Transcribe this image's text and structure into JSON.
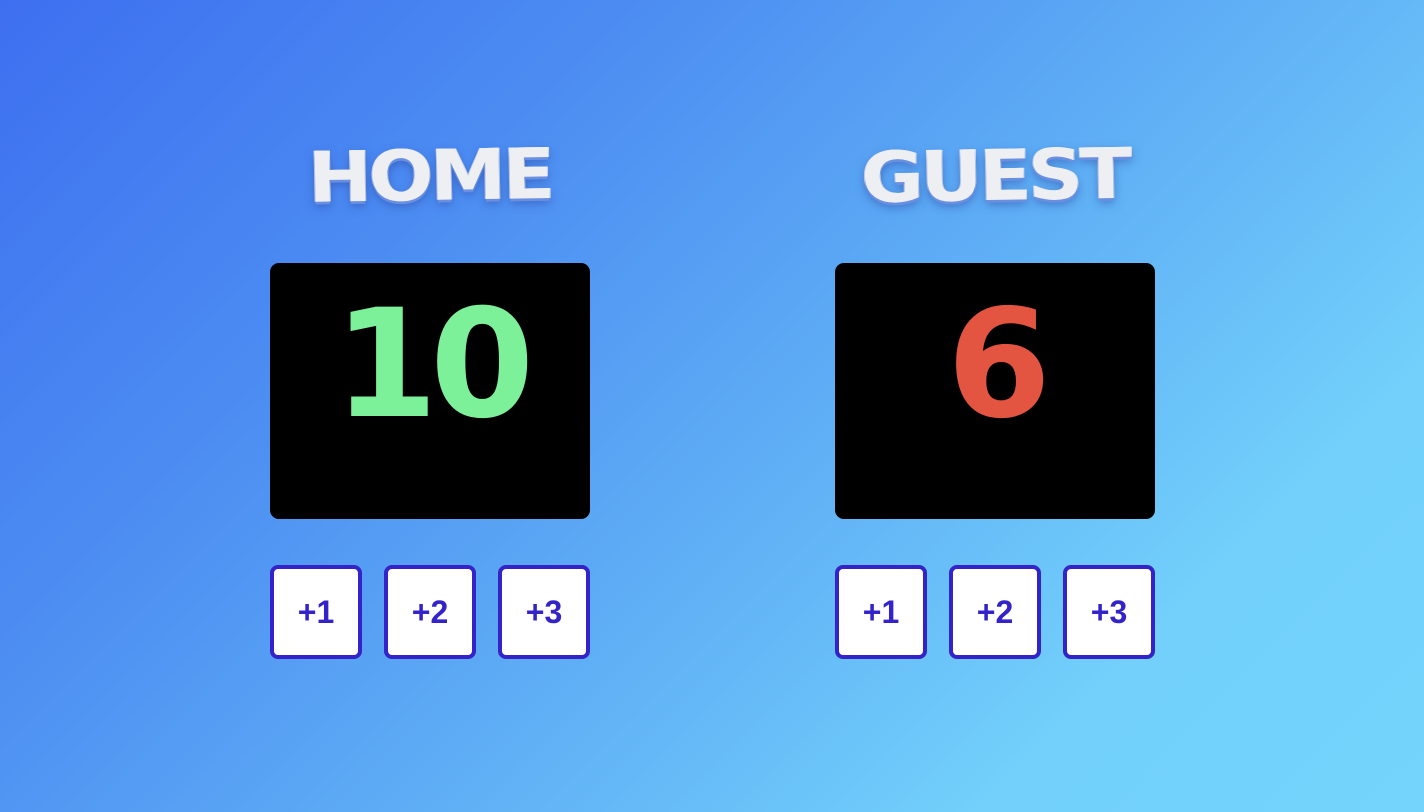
{
  "home": {
    "name": "HOME",
    "score": "10",
    "score_color": "#7cf199",
    "buttons": [
      "+1",
      "+2",
      "+3"
    ]
  },
  "guest": {
    "name": "GUEST",
    "score": "6",
    "score_color": "#e35441",
    "buttons": [
      "+1",
      "+2",
      "+3"
    ]
  },
  "colors": {
    "background_start": "#3d6ff0",
    "background_end": "#74d4fb",
    "scoreboard_bg": "#000000",
    "button_border": "#3323c8",
    "button_text": "#3323c8",
    "team_name": "#eeeff2"
  }
}
